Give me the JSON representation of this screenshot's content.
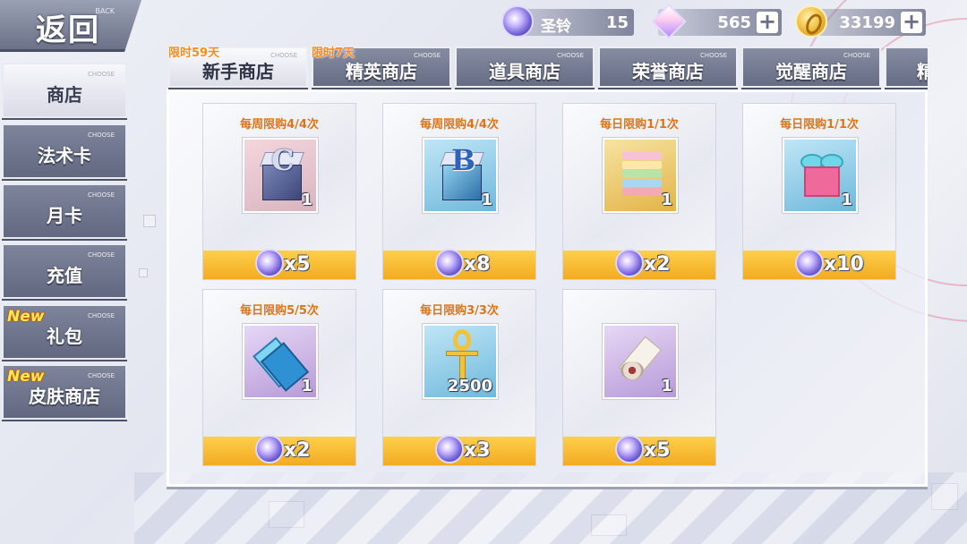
{
  "back": {
    "label": "返回",
    "sub": "BACK"
  },
  "currencies": [
    {
      "name": "圣铃",
      "value": "15",
      "icon": "bell-orb-icon"
    },
    {
      "name": "",
      "value": "565",
      "icon": "gem-icon",
      "plus": "+"
    },
    {
      "name": "",
      "value": "33199",
      "icon": "gold-coin-icon",
      "plus": "+"
    }
  ],
  "sidebar": {
    "choose": "CHOOSE",
    "new_badge": "New",
    "items": [
      {
        "label": "商店"
      },
      {
        "label": "法术卡"
      },
      {
        "label": "月卡"
      },
      {
        "label": "充值"
      },
      {
        "label": "礼包"
      },
      {
        "label": "皮肤商店"
      }
    ]
  },
  "tabs": {
    "choose": "CHOOSE",
    "items": [
      {
        "label": "新手商店",
        "limit": "限时59天"
      },
      {
        "label": "精英商店",
        "limit": "限时7天"
      },
      {
        "label": "道具商店"
      },
      {
        "label": "荣誉商店"
      },
      {
        "label": "觉醒商店"
      },
      {
        "label": "精"
      }
    ]
  },
  "shop_items": [
    {
      "limit": "每周限购4/4次",
      "qty": "1",
      "price": "x5",
      "art": "cube-c"
    },
    {
      "limit": "每周限购4/4次",
      "qty": "1",
      "price": "x8",
      "art": "cube-b"
    },
    {
      "limit": "每日限购1/1次",
      "qty": "1",
      "price": "x2",
      "art": "layer-cake"
    },
    {
      "limit": "每日限购1/1次",
      "qty": "1",
      "price": "x10",
      "art": "gift-box"
    },
    {
      "limit": "每日限购5/5次",
      "qty": "1",
      "price": "x2",
      "art": "card-stack"
    },
    {
      "limit": "每日限购3/3次",
      "qty": "2500",
      "price": "x3",
      "art": "gold-ankh"
    },
    {
      "limit": "",
      "qty": "1",
      "price": "x5",
      "art": "scroll"
    }
  ],
  "colors": {
    "price_bar": "#f2ab22",
    "limit_text": "#d9751c",
    "tab_limit": "#ff8a1e",
    "new_badge": "#ffe55a"
  }
}
